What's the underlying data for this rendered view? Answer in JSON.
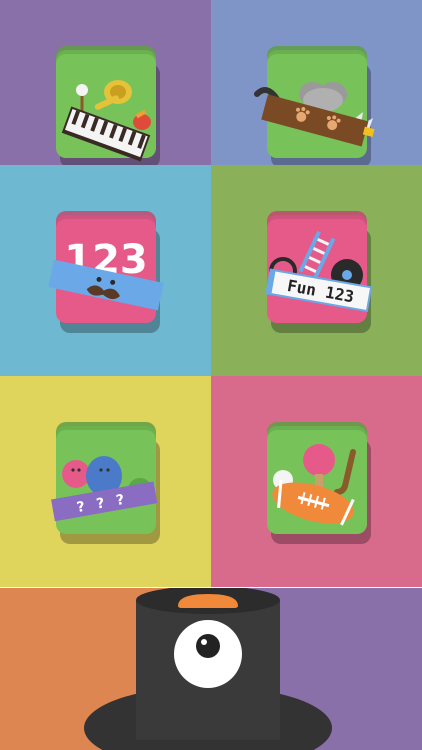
{
  "colors": {
    "cell_music": "#8a70a8",
    "cell_animals": "#7f95c7",
    "cell_numbers": "#6fb8d2",
    "cell_fun123": "#8ab05a",
    "cell_colors": "#dfd45c",
    "cell_sports": "#d86a8c",
    "bottom_left": "#dd8651",
    "bottom_right": "#8a70a8",
    "tile_green": "#77c35a",
    "tile_pink": "#e65a8a",
    "banner_blue": "#6aa8e8",
    "banner_purple": "#8a6cc2",
    "hat_dark": "#3a3a3a",
    "hat_orange": "#f08a3a"
  },
  "tiles": {
    "numbers_label": "123",
    "fun_label": "Fun 123",
    "mystery_marks": [
      "?",
      "?",
      "?"
    ]
  },
  "icons": {
    "music": "music-instruments-icon",
    "animals": "animal-box-icon",
    "numbers": "number-mustache-icon",
    "fun": "fun-123-icon",
    "colors": "color-blobs-icon",
    "sports": "sports-balls-icon",
    "mascot": "top-hat-eye-mascot-icon"
  }
}
